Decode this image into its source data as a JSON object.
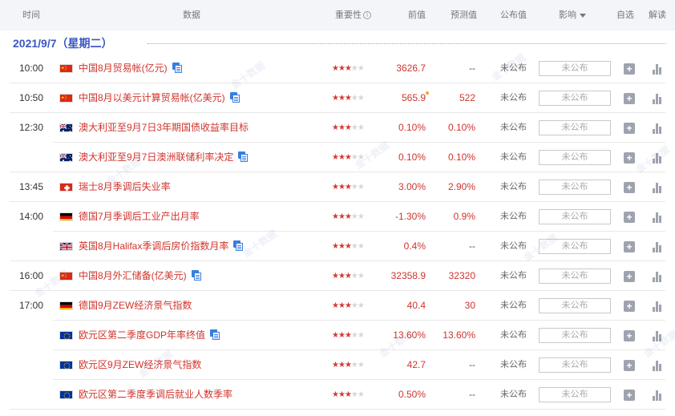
{
  "header": {
    "time": "时间",
    "data": "数据",
    "importance": "重要性",
    "previous": "前值",
    "forecast": "预测值",
    "published": "公布值",
    "impact": "影响",
    "favorite": "自选",
    "interpret": "解读"
  },
  "date": "2021/9/7（星期二）",
  "events": [
    {
      "time": "10:00",
      "flag": "cn",
      "name": "中国8月贸易帐(亿元)",
      "doc": true,
      "stars": 3,
      "previous": "3626.7",
      "forecast": "--",
      "published": "未公布",
      "impact": "未公布",
      "revised": false
    },
    {
      "time": "10:50",
      "flag": "cn",
      "name": "中国8月以美元计算贸易帐(亿美元)",
      "doc": true,
      "stars": 3,
      "previous": "565.9",
      "forecast": "522",
      "published": "未公布",
      "impact": "未公布",
      "revised": true
    },
    {
      "time": "12:30",
      "flag": "au",
      "name": "澳大利亚至9月7日3年期国债收益率目标",
      "doc": false,
      "stars": 3,
      "previous": "0.10%",
      "forecast": "0.10%",
      "published": "未公布",
      "impact": "未公布",
      "revised": false
    },
    {
      "time": "",
      "flag": "au",
      "name": "澳大利亚至9月7日澳洲联储利率决定",
      "doc": true,
      "stars": 3,
      "previous": "0.10%",
      "forecast": "0.10%",
      "published": "未公布",
      "impact": "未公布",
      "revised": false
    },
    {
      "time": "13:45",
      "flag": "ch",
      "name": "瑞士8月季调后失业率",
      "doc": false,
      "stars": 3,
      "previous": "3.00%",
      "forecast": "2.90%",
      "published": "未公布",
      "impact": "未公布",
      "revised": false
    },
    {
      "time": "14:00",
      "flag": "de",
      "name": "德国7月季调后工业产出月率",
      "doc": false,
      "stars": 3,
      "previous": "-1.30%",
      "forecast": "0.9%",
      "published": "未公布",
      "impact": "未公布",
      "revised": false
    },
    {
      "time": "",
      "flag": "gb",
      "name": "英国8月Halifax季调后房价指数月率",
      "doc": true,
      "stars": 3,
      "previous": "0.4%",
      "forecast": "--",
      "published": "未公布",
      "impact": "未公布",
      "revised": false
    },
    {
      "time": "16:00",
      "flag": "cn",
      "name": "中国8月外汇储备(亿美元)",
      "doc": true,
      "stars": 3,
      "previous": "32358.9",
      "forecast": "32320",
      "published": "未公布",
      "impact": "未公布",
      "revised": false
    },
    {
      "time": "17:00",
      "flag": "de",
      "name": "德国9月ZEW经济景气指数",
      "doc": false,
      "stars": 3,
      "previous": "40.4",
      "forecast": "30",
      "published": "未公布",
      "impact": "未公布",
      "revised": false
    },
    {
      "time": "",
      "flag": "eu",
      "name": "欧元区第二季度GDP年率终值",
      "doc": true,
      "stars": 3,
      "previous": "13.60%",
      "forecast": "13.60%",
      "published": "未公布",
      "impact": "未公布",
      "revised": false
    },
    {
      "time": "",
      "flag": "eu",
      "name": "欧元区9月ZEW经济景气指数",
      "doc": false,
      "stars": 3,
      "previous": "42.7",
      "forecast": "--",
      "published": "未公布",
      "impact": "未公布",
      "revised": false
    },
    {
      "time": "",
      "flag": "eu",
      "name": "欧元区第二季度季调后就业人数季率",
      "doc": false,
      "stars": 3,
      "previous": "0.50%",
      "forecast": "--",
      "published": "未公布",
      "impact": "未公布",
      "revised": false
    }
  ],
  "watermark": "金十数据",
  "colors": {
    "accent": "#3a57c4",
    "event_red": "#d0342c",
    "header_bg": "#f4f5f9"
  }
}
